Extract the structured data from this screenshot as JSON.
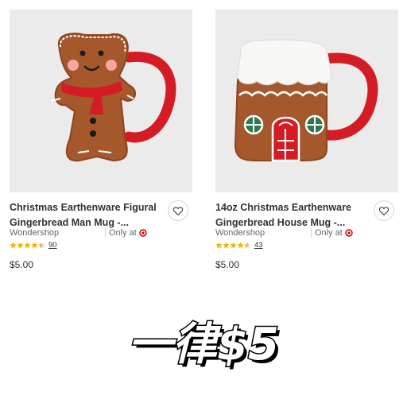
{
  "products": [
    {
      "title_line1": "Christmas Earthenware Figural",
      "title_line2": "Gingerbread Man Mug -...",
      "brand": "Wondershop",
      "availability": "Only at",
      "rating": 4.5,
      "review_count": "90",
      "price": "$5.00",
      "image_icon": "gingerbread-man-mug-image"
    },
    {
      "title_line1": "14oz Christmas Earthenware",
      "title_line2": "Gingerbread House Mug -...",
      "brand": "Wondershop",
      "availability": "Only at",
      "rating": 4.5,
      "review_count": "43",
      "price": "$5.00",
      "image_icon": "gingerbread-house-mug-image"
    }
  ],
  "headline": "一律$5",
  "colors": {
    "target_red": "#cc0000",
    "star_gold": "#f2b400",
    "mug_brown": "#a5582c",
    "mug_red": "#d41c24"
  }
}
